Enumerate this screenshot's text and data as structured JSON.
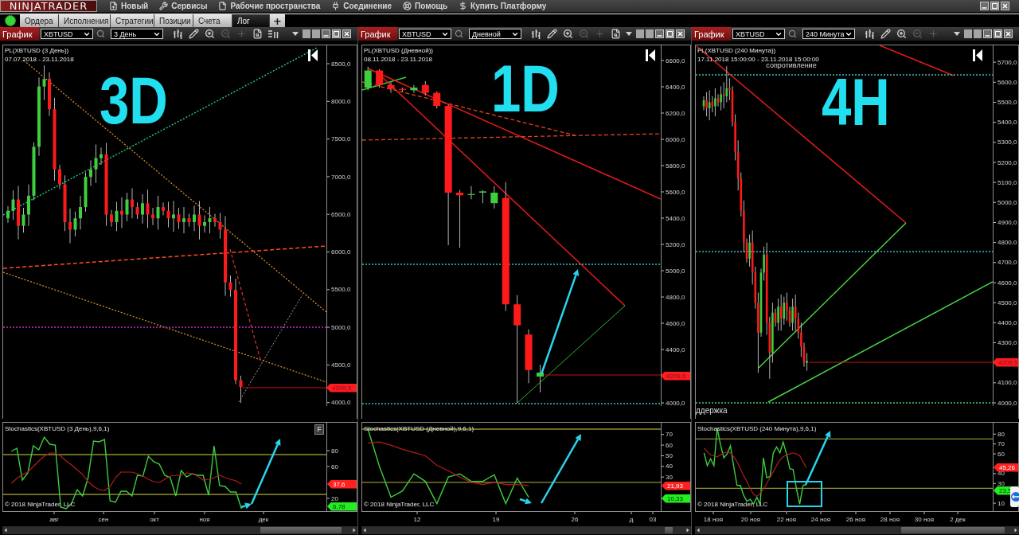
{
  "app": {
    "logo": "NINJATRADER",
    "menu": [
      {
        "kind": "new",
        "label": "Новый"
      },
      {
        "kind": "tools",
        "label": "Сервисы"
      },
      {
        "kind": "workspaces",
        "label": "Рабочие пространства"
      },
      {
        "kind": "connection",
        "label": "Соединение"
      },
      {
        "kind": "help",
        "label": "Помощь"
      },
      {
        "kind": "buy",
        "label": "Купить Платформу"
      }
    ]
  },
  "tabs": {
    "connected": true,
    "items": [
      {
        "label": "Ордера",
        "selected": false
      },
      {
        "label": "Исполнения",
        "selected": false
      },
      {
        "label": "Стратегии",
        "selected": false
      },
      {
        "label": "Позиции",
        "selected": false
      },
      {
        "label": "Счета",
        "selected": false
      },
      {
        "label": "Лог",
        "selected": true
      }
    ],
    "add": "+"
  },
  "charts": [
    {
      "header": {
        "title": "График",
        "instrument": "XBTUSD",
        "period": "3 День",
        "tools": [
          {
            "kind": "bars",
            "disabled": false
          },
          {
            "kind": "pencil",
            "disabled": false
          },
          {
            "kind": "zoom-in",
            "disabled": false
          },
          {
            "kind": "zoom-out",
            "disabled": true
          },
          {
            "kind": "crosshair",
            "disabled": true
          },
          {
            "kind": "properties",
            "disabled": false
          },
          {
            "kind": "list",
            "disabled": false
          }
        ]
      },
      "price_panel": {
        "legend": "PL(XBTUSD (3 День))",
        "range": "07.07.2018 - 23.11.2018",
        "label": "3D",
        "axis": [
          "8500,0",
          "8000,0",
          "7500,0",
          "7000,0",
          "6500,0",
          "6000,0",
          "5500,0",
          "5000,0",
          "4500,0",
          "4000,0"
        ],
        "price_tag": "4209,5"
      },
      "indicator_panel": {
        "button": "F",
        "copyright": "© 2018 NinjaTrader, LLC",
        "tags": [
          {
            "text": "37,6",
            "color": "#ff2020"
          },
          {
            "text": "6,78",
            "color": "#22ee22"
          }
        ],
        "chart_data": {
          "type": "line",
          "title": "Stochastics(XBTUSD (3 День),9,6,1)",
          "ylim": [
            4,
            115
          ],
          "yticks": [
            20,
            60,
            80
          ],
          "categories": [
            null,
            null,
            null,
            null,
            null,
            null,
            null,
            null,
            null,
            null,
            null,
            null,
            null,
            null,
            null,
            null,
            null,
            null,
            null,
            null,
            null,
            null,
            null,
            null,
            null,
            null,
            null,
            null,
            null,
            null,
            null,
            null,
            null,
            null,
            null,
            null,
            null,
            null,
            null,
            null,
            null,
            null,
            null,
            null,
            null,
            null,
            null,
            null,
            null,
            null,
            null,
            null,
            null,
            null,
            null,
            null,
            null,
            null,
            null
          ],
          "series": [
            {
              "color": "#3ccf3c",
              "values": [
                null,
                79,
                83,
                43,
                52,
                86,
                81,
                97,
                88,
                87,
                9,
                7,
                14,
                31,
                23,
                46,
                92,
                91,
                94,
                17,
                15,
                29,
                29,
                23,
                49,
                48,
                73,
                66,
                63,
                49,
                46,
                23,
                55,
                47,
                51,
                49,
                49,
                24,
                86,
                36,
                35,
                28,
                28,
                7,
                null,
                null,
                null,
                null,
                null,
                null,
                null,
                null,
                null,
                null,
                null,
                null,
                null,
                null,
                null
              ]
            },
            {
              "color": "#b31c1c",
              "values": [
                null,
                39,
                45,
                50,
                53,
                60,
                67,
                73,
                77,
                77,
                73,
                67,
                62,
                56,
                50,
                41,
                35,
                31,
                30,
                35,
                46,
                53,
                53,
                53,
                51,
                48,
                44,
                41,
                40,
                44,
                48,
                49,
                49,
                52,
                51,
                48,
                43,
                44,
                46,
                49,
                46,
                44,
                42,
                38,
                null,
                null,
                null,
                null,
                null,
                null,
                null,
                null,
                null,
                null,
                null,
                null,
                null,
                null,
                null
              ]
            }
          ],
          "ref_lines": [
            {
              "axis": "y",
              "value": 75
            },
            {
              "axis": "y",
              "value": 25
            }
          ]
        }
      },
      "time_axis": [
        "авг",
        "сен",
        "окт",
        "ноя",
        "дек"
      ]
    },
    {
      "header": {
        "title": "График",
        "instrument": "XBTUSD",
        "period": "Дневной",
        "tools": [
          {
            "kind": "bars",
            "disabled": false
          },
          {
            "kind": "pencil",
            "disabled": false
          },
          {
            "kind": "zoom-in",
            "disabled": false
          },
          {
            "kind": "zoom-out",
            "disabled": true
          },
          {
            "kind": "crosshair",
            "disabled": true
          },
          {
            "kind": "properties",
            "disabled": false
          }
        ]
      },
      "price_panel": {
        "legend": "PL(XBTUSD (Дневной))",
        "range": "08.11.2018 - 23.11.2018",
        "label": "1D",
        "axis": [
          "6600,0",
          "6400,0",
          "6200,0",
          "6000,0",
          "5800,0",
          "5600,0",
          "5400,0",
          "5200,0",
          "5000,0",
          "4800,0",
          "4600,0",
          "4400,0",
          "4000,0"
        ],
        "price_tag": "4209,5"
      },
      "indicator_panel": {
        "copyright": "© 2018 NinjaTrader, LLC",
        "tags": [
          {
            "text": "21,93",
            "color": "#ff2020"
          },
          {
            "text": "10,33",
            "color": "#22ee22"
          }
        ],
        "chart_data": {
          "type": "line",
          "title": "Stochastics(XBTUSD (Дневной),9,6,1)",
          "ylim": [
            -2,
            81
          ],
          "yticks": [
            30,
            40,
            50,
            60,
            70
          ],
          "categories": [
            null,
            null,
            null,
            null,
            null,
            null,
            null,
            null,
            null,
            null,
            null,
            null,
            null,
            null,
            null,
            null,
            null,
            null,
            null,
            null,
            null,
            null,
            null,
            null,
            null,
            null
          ],
          "series": [
            {
              "color": "#3ccf3c",
              "values": [
                75,
                40,
                11,
                17,
                33,
                26,
                5,
                30,
                33,
                26,
                26,
                32,
                5,
                29,
                11,
                null,
                null,
                null,
                null,
                null,
                null,
                null,
                null,
                null,
                null,
                null
              ]
            },
            {
              "color": "#b31c1c",
              "values": [
                62,
                63,
                60,
                56,
                53,
                50,
                41,
                36,
                30,
                25,
                23,
                25,
                23,
                23,
                22,
                null,
                null,
                null,
                null,
                null,
                null,
                null,
                null,
                null,
                null,
                null
              ]
            }
          ],
          "ref_lines": [
            {
              "axis": "y",
              "value": 75
            },
            {
              "axis": "y",
              "value": 25
            }
          ]
        }
      },
      "time_axis": [
        "12",
        "19",
        "26",
        "д",
        "03"
      ]
    },
    {
      "header": {
        "title": "График",
        "instrument": "XBTUSD",
        "period": "240 Минута",
        "tools": [
          {
            "kind": "bars",
            "disabled": false
          },
          {
            "kind": "pencil",
            "disabled": false
          },
          {
            "kind": "zoom-in",
            "disabled": false
          },
          {
            "kind": "zoom-out",
            "disabled": true
          },
          {
            "kind": "crosshair",
            "disabled": true
          }
        ]
      },
      "price_panel": {
        "legend": "PL(XBTUSD (240 Минута))",
        "range": "17.11.2018 15:00:00 - 23.11.2018 15:00:00",
        "label": "4H",
        "notes": [
          {
            "text": "сопротивление"
          },
          {
            "text": "ддержка"
          }
        ],
        "axis": [
          "5700,0",
          "5600,0",
          "5500,0",
          "5400,0",
          "5300,0",
          "5200,0",
          "5100,0",
          "5000,0",
          "4900,0",
          "4800,0",
          "4700,0",
          "4600,0",
          "4500,0",
          "4400,0",
          "4300,0",
          "4100,0",
          "4000,0"
        ],
        "price_tag": "4209,5"
      },
      "indicator_panel": {
        "copyright": "© 2018 NinjaTrader, LLC",
        "tags": [
          {
            "text": "45,26",
            "color": "#ff2020"
          },
          {
            "text": "23,5",
            "color": "#22ee22"
          }
        ],
        "chart_data": {
          "type": "line",
          "title": "Stochastics(XBTUSD (240 Минута),9,6,1)",
          "ylim": [
            2,
            91.5
          ],
          "yticks": [
            10,
            30,
            40,
            60,
            70,
            80
          ],
          "categories": [
            null,
            null,
            null,
            null,
            null,
            null,
            null,
            null,
            null,
            null,
            null,
            null,
            null,
            null,
            null,
            null,
            null,
            null,
            null,
            null,
            null,
            null,
            null,
            null,
            null,
            null,
            null,
            null,
            null,
            null,
            null,
            null,
            null,
            null,
            null,
            null,
            null,
            null,
            null,
            null,
            null,
            null,
            null,
            null,
            null,
            null,
            null,
            null,
            null,
            null,
            null,
            null,
            null,
            null,
            null,
            null,
            null,
            null,
            null,
            null,
            null,
            null,
            null,
            null,
            null,
            null,
            null,
            null,
            null,
            null,
            null,
            null,
            null,
            null,
            null,
            null,
            null,
            null,
            null,
            null,
            null,
            null,
            null,
            null,
            null,
            null,
            null,
            null,
            null,
            null
          ],
          "series": [
            {
              "color": "#3ccf3c",
              "values": [
                null,
                null,
                61,
                48,
                55,
                48,
                86,
                69,
                56,
                60,
                68,
                47,
                28,
                28,
                18,
                12,
                14,
                9,
                16,
                9,
                56,
                36,
                37,
                61,
                67,
                61,
                72,
                60,
                45,
                44,
                25,
                9,
                28,
                29,
                null,
                null,
                null,
                null,
                null,
                null,
                null,
                null,
                null,
                null,
                null,
                null,
                null,
                null,
                null,
                null,
                null,
                null,
                null,
                null,
                null,
                null,
                null,
                null,
                null,
                null,
                null,
                null,
                null,
                null,
                null,
                null,
                null,
                null,
                null,
                null,
                null,
                null,
                null,
                null,
                null,
                null,
                null,
                null,
                null,
                null,
                null,
                null,
                null,
                null,
                null,
                null,
                null,
                null,
                null,
                null
              ]
            },
            {
              "color": "#b31c1c",
              "values": [
                null,
                null,
                66,
                62,
                59,
                58,
                57,
                59,
                61,
                62,
                61,
                57,
                52,
                45,
                38,
                32,
                25,
                19,
                17,
                20,
                24,
                30,
                36,
                42,
                48,
                54,
                57,
                59,
                60,
                61,
                60,
                58,
                52,
                46,
                null,
                null,
                null,
                null,
                null,
                null,
                null,
                null,
                null,
                null,
                null,
                null,
                null,
                null,
                null,
                null,
                null,
                null,
                null,
                null,
                null,
                null,
                null,
                null,
                null,
                null,
                null,
                null,
                null,
                null,
                null,
                null,
                null,
                null,
                null,
                null,
                null,
                null,
                null,
                null,
                null,
                null,
                null,
                null,
                null,
                null,
                null,
                null,
                null,
                null,
                null,
                null,
                null,
                null,
                null,
                null
              ]
            }
          ],
          "ref_lines": [
            {
              "axis": "y",
              "value": 75
            },
            {
              "axis": "y",
              "value": 25
            }
          ]
        }
      },
      "time_axis": [
        "18 ноя",
        "20 ноя",
        "22 ноя",
        "24 ноя",
        "26 ноя",
        "28 ноя",
        "30 ноя",
        "2 дек"
      ]
    }
  ]
}
